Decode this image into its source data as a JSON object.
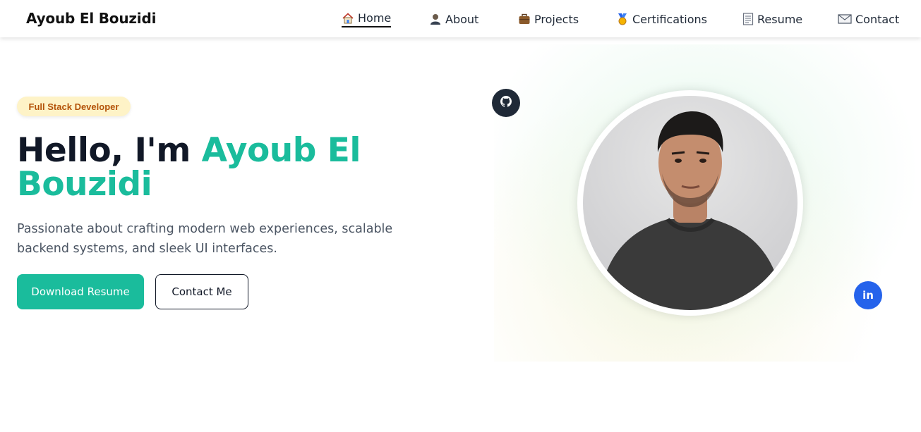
{
  "brand": "Ayoub El Bouzidi",
  "nav": [
    {
      "icon": "house-icon",
      "label": "Home",
      "active": true
    },
    {
      "icon": "person-icon",
      "label": "About",
      "active": false
    },
    {
      "icon": "briefcase-icon",
      "label": "Projects",
      "active": false
    },
    {
      "icon": "medal-icon",
      "label": "Certifications",
      "active": false
    },
    {
      "icon": "document-icon",
      "label": "Resume",
      "active": false
    },
    {
      "icon": "envelope-icon",
      "label": "Contact",
      "active": false
    }
  ],
  "hero": {
    "badge": "Full Stack Developer",
    "headline_prefix": "Hello, I'm ",
    "headline_name": "Ayoub El Bouzidi",
    "tagline": "Passionate about crafting modern web experiences, scalable backend systems, and sleek UI interfaces.",
    "primary_button": "Download Resume",
    "secondary_button": "Contact Me",
    "social": [
      {
        "icon": "github-icon"
      },
      {
        "icon": "linkedin-icon",
        "text": "in"
      }
    ]
  },
  "colors": {
    "accent": "#1abc9c",
    "badge_bg": "#fef3c7",
    "badge_text": "#b45309",
    "heading": "#111827",
    "linkedin": "#2563eb",
    "github": "#1f2937"
  }
}
